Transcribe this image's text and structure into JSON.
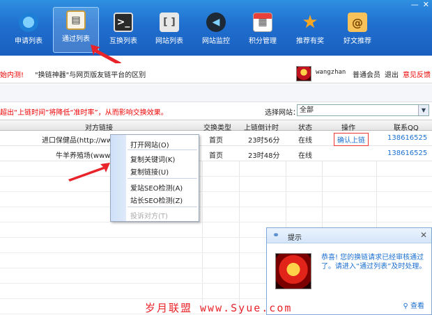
{
  "window": {
    "min": "—",
    "close": "✕"
  },
  "toolbar": {
    "items": [
      {
        "label": "申请列表",
        "icon": "globe-icon",
        "color": "#2f9d3f"
      },
      {
        "label": "通过列表",
        "icon": "clipboard-icon",
        "color": "#f2c14e",
        "active": true
      },
      {
        "label": "互换列表",
        "icon": "terminal-icon",
        "color": "#333333"
      },
      {
        "label": "网站列表",
        "icon": "bracket-icon",
        "color": "#dddddd"
      },
      {
        "label": "网站监控",
        "icon": "monitor-icon",
        "color": "#2b3d4f"
      },
      {
        "label": "积分管理",
        "icon": "calendar-icon",
        "color": "#e8413a"
      },
      {
        "label": "推荐有奖",
        "icon": "star-icon",
        "color": "#f5a623"
      },
      {
        "label": "好文推荐",
        "icon": "at-icon",
        "color": "#f0a030"
      }
    ]
  },
  "notice": {
    "red_text": "始内测!",
    "text": "\"换链神器\"与网页版友链平台的区别",
    "username": "wangzhan",
    "member": "普通会员",
    "logout": "退出",
    "feedback": "意见反馈"
  },
  "filter": {
    "warning": "超出“上链时间”将降低“准时率”，从而影响交换效果。",
    "site_label": "选择网站：",
    "site_value": "全部"
  },
  "table": {
    "headers": [
      "对方链接",
      "交换类型",
      "上链倒计时",
      "状态",
      "操作",
      "联系QQ"
    ],
    "rows": [
      {
        "link": "进口保健品(http://www",
        "type": "首页",
        "countdown": "23时56分",
        "status": "在线",
        "action": "确认上链",
        "qq": "138616525"
      },
      {
        "link": "牛羊养殖场(www.ni",
        "type": "首页",
        "countdown": "23时48分",
        "status": "在线",
        "action": "",
        "qq": "138616525"
      }
    ]
  },
  "context_menu": {
    "items": [
      {
        "label": "打开网站(O)",
        "disabled": false
      },
      {
        "label": "复制关键词(K)",
        "disabled": false
      },
      {
        "label": "复制链接(U)",
        "disabled": false
      },
      {
        "label": "爱站SEO检测(A)",
        "disabled": false
      },
      {
        "label": "站长SEO检测(Z)",
        "disabled": false
      },
      {
        "label": "投诉对方(T)",
        "disabled": true
      }
    ]
  },
  "popup": {
    "title": "提示",
    "message": "恭喜! 您的换链请求已经审核通过了。请进入“通过列表”及时处理。",
    "view": "查看"
  },
  "watermark": "岁月联盟 www.Syue.com",
  "accent_colors": {
    "toolbar": "#1f6fcf",
    "alert": "#e00000",
    "link": "#1a6fd0"
  }
}
